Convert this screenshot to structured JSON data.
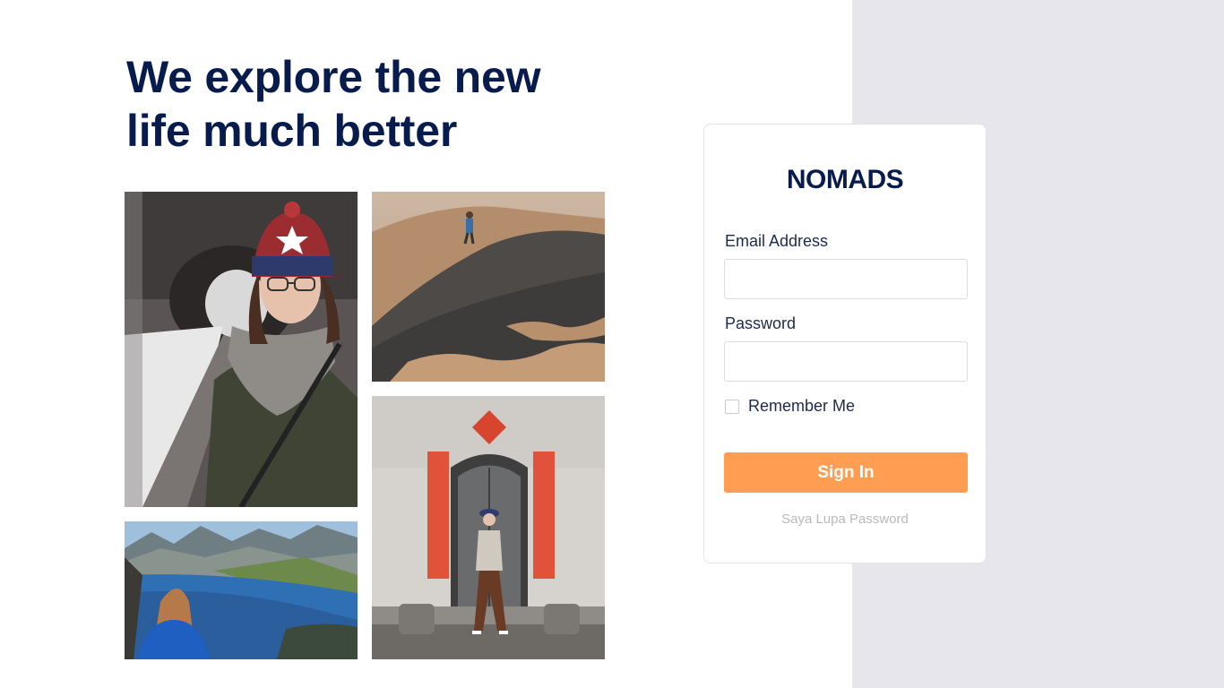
{
  "headline": {
    "line1": "We explore the new",
    "line2": "life much better"
  },
  "login": {
    "logo_text": "NOMADS",
    "email_label": "Email Address",
    "email_value": "",
    "password_label": "Password",
    "password_value": "",
    "remember_label": "Remember Me",
    "signin_label": "Sign In",
    "forgot_label": "Saya Lupa Password"
  },
  "gallery": {
    "photos": [
      {
        "subject": "woman in winter hat near tunnel"
      },
      {
        "subject": "person walking on sand dunes"
      },
      {
        "subject": "woman overlooking fjord and mountains"
      },
      {
        "subject": "woman in front of old doorway with red scrolls"
      }
    ]
  },
  "colors": {
    "brand_navy": "#071c4d",
    "accent_orange": "#ff9e53",
    "panel_gray": "#e6e6ec"
  }
}
